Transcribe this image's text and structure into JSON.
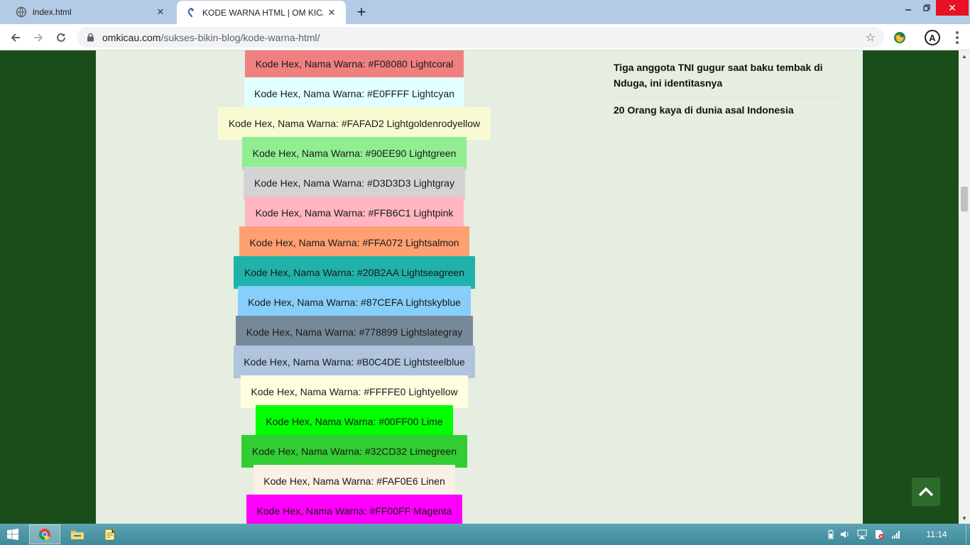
{
  "browser": {
    "tabs": [
      {
        "title": "index.html",
        "icon": "globe-icon",
        "active": false
      },
      {
        "title": "KODE WARNA HTML | OM KICAU",
        "icon": "site-favicon-icon",
        "active": true
      }
    ],
    "new_tab": "+",
    "url_host": "omkicau.com",
    "url_path": "/sukses-bikin-blog/kode-warna-html/"
  },
  "colors": [
    {
      "label": "Kode Hex, Nama Warna: #F08080 Lightcoral",
      "bg": "#F08080"
    },
    {
      "label": "Kode Hex, Nama Warna: #E0FFFF Lightcyan",
      "bg": "#E0FFFF"
    },
    {
      "label": "Kode Hex, Nama Warna: #FAFAD2 Lightgoldenrodyellow",
      "bg": "#FAFAD2"
    },
    {
      "label": "Kode Hex, Nama Warna: #90EE90 Lightgreen",
      "bg": "#90EE90"
    },
    {
      "label": "Kode Hex, Nama Warna: #D3D3D3 Lightgray",
      "bg": "#D3D3D3"
    },
    {
      "label": "Kode Hex, Nama Warna: #FFB6C1 Lightpink",
      "bg": "#FFB6C1"
    },
    {
      "label": "Kode Hex, Nama Warna: #FFA072 Lightsalmon",
      "bg": "#FFA072"
    },
    {
      "label": "Kode Hex, Nama Warna: #20B2AA Lightseagreen",
      "bg": "#20B2AA"
    },
    {
      "label": "Kode Hex, Nama Warna: #87CEFA Lightskyblue",
      "bg": "#87CEFA"
    },
    {
      "label": "Kode Hex, Nama Warna: #778899 Lightslategray",
      "bg": "#778899"
    },
    {
      "label": "Kode Hex, Nama Warna: #B0C4DE Lightsteelblue",
      "bg": "#B0C4DE"
    },
    {
      "label": "Kode Hex, Nama Warna: #FFFFE0 Lightyellow",
      "bg": "#FFFFE0"
    },
    {
      "label": "Kode Hex, Nama Warna: #00FF00 Lime",
      "bg": "#00FF00"
    },
    {
      "label": "Kode Hex, Nama Warna: #32CD32 Limegreen",
      "bg": "#32CD32"
    },
    {
      "label": "Kode Hex, Nama Warna: #FAF0E6 Linen",
      "bg": "#FAF0E6"
    },
    {
      "label": "Kode Hex, Nama Warna: #FF00FF Magenta",
      "bg": "#FF00FF"
    }
  ],
  "sidebar": {
    "links": [
      "Tiga anggota TNI gugur saat baku tembak di Nduga, ini identitasnya",
      "20 Orang kaya di dunia asal Indonesia"
    ]
  },
  "taskbar": {
    "clock": "11:14",
    "pinned": [
      "chrome-icon",
      "file-explorer-icon",
      "notes-icon"
    ]
  },
  "theme": {
    "page_bg": "#1b4d1a",
    "content_bg": "#e6ede1",
    "accent": "#2e6b2b"
  }
}
